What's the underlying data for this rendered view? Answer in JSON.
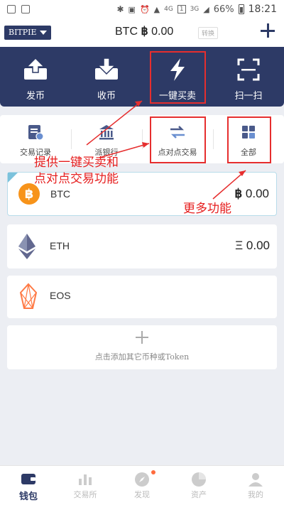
{
  "status_bar": {
    "time": "18:21",
    "battery": "66%",
    "net1": "4G",
    "net2": "3G",
    "sim": "1"
  },
  "topbar": {
    "wallet_name": "BITPIE",
    "balance_unit": "BTC",
    "balance_symbol": "฿",
    "balance_value": "0.00",
    "badge": "转换"
  },
  "hero": [
    {
      "label": "发币",
      "icon": "send-icon"
    },
    {
      "label": "收币",
      "icon": "receive-icon"
    },
    {
      "label": "一键买卖",
      "icon": "lightning-icon"
    },
    {
      "label": "扫一扫",
      "icon": "scan-icon"
    }
  ],
  "quick": [
    {
      "label": "交易记录",
      "icon": "transaction-record-icon"
    },
    {
      "label": "派银行",
      "icon": "bank-icon"
    },
    {
      "label": "点对点交易",
      "icon": "exchange-arrows-icon"
    },
    {
      "label": "全部",
      "icon": "grid-icon"
    }
  ],
  "assets": [
    {
      "name": "BTC",
      "symbol": "฿",
      "balance": "0.00",
      "icon": "bitcoin-icon",
      "color": "#f7931a"
    },
    {
      "name": "ETH",
      "symbol": "Ξ",
      "balance": "0.00",
      "icon": "ethereum-icon",
      "color": "#3c3c3d"
    },
    {
      "name": "EOS",
      "symbol": "",
      "balance": "",
      "icon": "eos-icon",
      "color": "#ff7a45"
    }
  ],
  "add_token": {
    "label": "点击添加其它币种或Token"
  },
  "bottom_nav": [
    {
      "label": "钱包",
      "icon": "wallet-icon",
      "active": true
    },
    {
      "label": "交易所",
      "icon": "chart-icon",
      "active": false
    },
    {
      "label": "发现",
      "icon": "compass-icon",
      "active": false
    },
    {
      "label": "资产",
      "icon": "pie-icon",
      "active": false
    },
    {
      "label": "我的",
      "icon": "user-icon",
      "active": false
    }
  ],
  "annotations": {
    "line1": "提供一键买卖和",
    "line2": "点对点交易功能",
    "more": "更多功能"
  },
  "colors": {
    "primary": "#2d3a66",
    "annotation": "#e62e2e",
    "background": "#eceef3"
  }
}
